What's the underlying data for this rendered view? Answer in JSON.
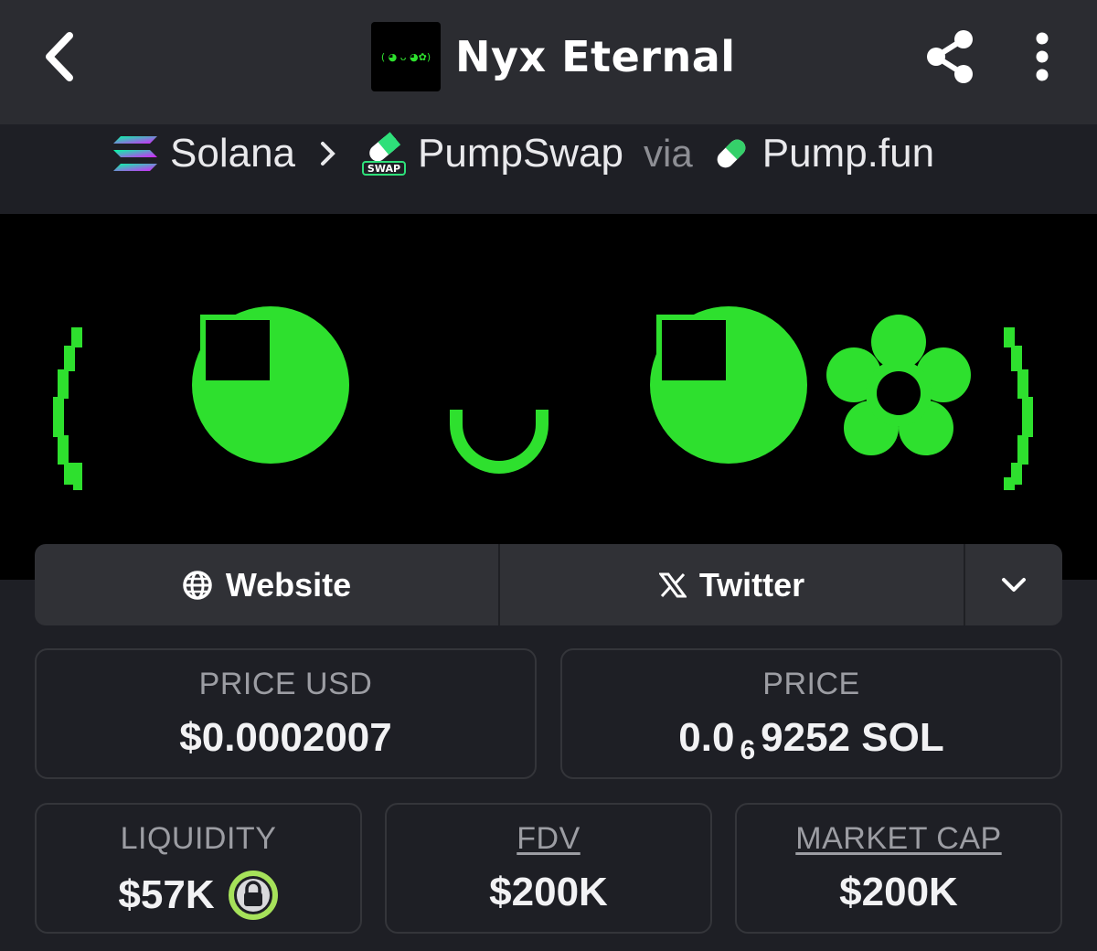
{
  "header": {
    "title": "Nyx Eternal",
    "thumbnail_text": "( ◕ ᴗ ◕✿)"
  },
  "breadcrumb": {
    "chain": "Solana",
    "dex": "PumpSwap",
    "dex_badge": "SWAP",
    "via": "via",
    "launchpad": "Pump.fun"
  },
  "banner": {
    "kaomoji": "( ◕ ᴗ ◕✿)",
    "color": "#2ee02e"
  },
  "links": {
    "website": "Website",
    "twitter": "Twitter"
  },
  "stats": {
    "price_usd_label": "PRICE USD",
    "price_usd_value": "$0.0002007",
    "price_label": "PRICE",
    "price_prefix": "0.0",
    "price_zero_count": "6",
    "price_suffix": "9252 SOL",
    "liquidity_label": "LIQUIDITY",
    "liquidity_value": "$57K",
    "fdv_label": "FDV",
    "fdv_value": "$200K",
    "mcap_label": "MARKET CAP",
    "mcap_value": "$200K"
  },
  "icons": {
    "back": "chevron-left-icon",
    "share": "share-icon",
    "more": "more-vertical-icon",
    "chain": "solana-icon",
    "dex": "pumpswap-icon",
    "launchpad": "pill-icon",
    "website": "globe-icon",
    "twitter": "x-icon",
    "expand": "chevron-down-icon",
    "lock": "lock-icon"
  },
  "colors": {
    "background": "#1e1f25",
    "header": "#2b2c31",
    "accent_green": "#2ee02e",
    "lock_ring": "#a6e25a"
  }
}
